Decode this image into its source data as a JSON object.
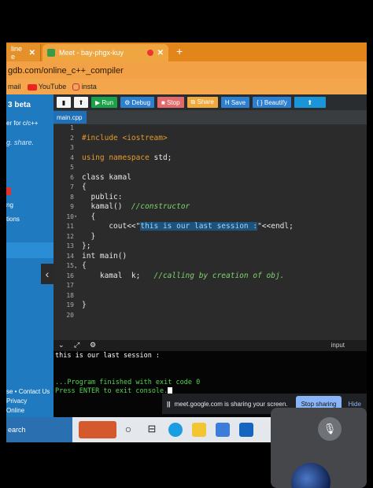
{
  "browser": {
    "tabs": [
      {
        "label": "line e",
        "close": "✕"
      },
      {
        "label": "Meet - bay-phgx-kuy",
        "close": "✕"
      }
    ],
    "new_tab": "+",
    "url": "gdb.com/online_c++_compiler",
    "bookmarks": [
      "mail",
      "YouTube",
      "insta"
    ]
  },
  "sidebar": {
    "brand": "beta",
    "brand_prefix": "3",
    "subtitle": "er for c/c++",
    "share_text": "g. share.",
    "items": [
      "ng",
      "tions"
    ],
    "links": [
      "se • Contact Us",
      "Privacy",
      "Online"
    ]
  },
  "toolbar": {
    "run": "▶ Run",
    "debug": "⚙ Debug",
    "stop": "■ Stop",
    "share": "⧉ Share",
    "save": "H Save",
    "beautify": "{ } Beautify",
    "upload": "⬆"
  },
  "editor": {
    "file_tab": "main.cpp",
    "line_numbers": [
      "1",
      "2",
      "3",
      "4",
      "5",
      "6",
      "7",
      "8",
      "9",
      "10",
      "11",
      "12",
      "13",
      "14",
      "15",
      "16",
      "17",
      "18",
      "19",
      "20"
    ],
    "lines": {
      "l2a": "#include ",
      "l2b": "<iostream>",
      "l4a": "using namespace",
      "l4b": " std;",
      "l6": "class kamal",
      "l7": "{",
      "l8": "  public:",
      "l9a": "  kamal()  ",
      "l9b": "//constructor",
      "l10": "  {",
      "l11a": "      cout<<\"",
      "l11b": "this is our last session :",
      "l11c": "\"<<endl;",
      "l12": "  }",
      "l13": "};",
      "l14": "int main()",
      "l15": "{",
      "l16a": "    kamal  k;   ",
      "l16b": "//calling by creation of obj.",
      "l19": "}"
    }
  },
  "console": {
    "input_label": "input",
    "output_line": "this is our last session :",
    "finished": "...Program finished with exit code 0",
    "press_enter": "Press ENTER to exit console."
  },
  "share_banner": {
    "pause": "||",
    "message": "meet.google.com is sharing your screen.",
    "stop": "Stop sharing",
    "hide": "Hide"
  },
  "taskbar": {
    "search": "earch"
  }
}
